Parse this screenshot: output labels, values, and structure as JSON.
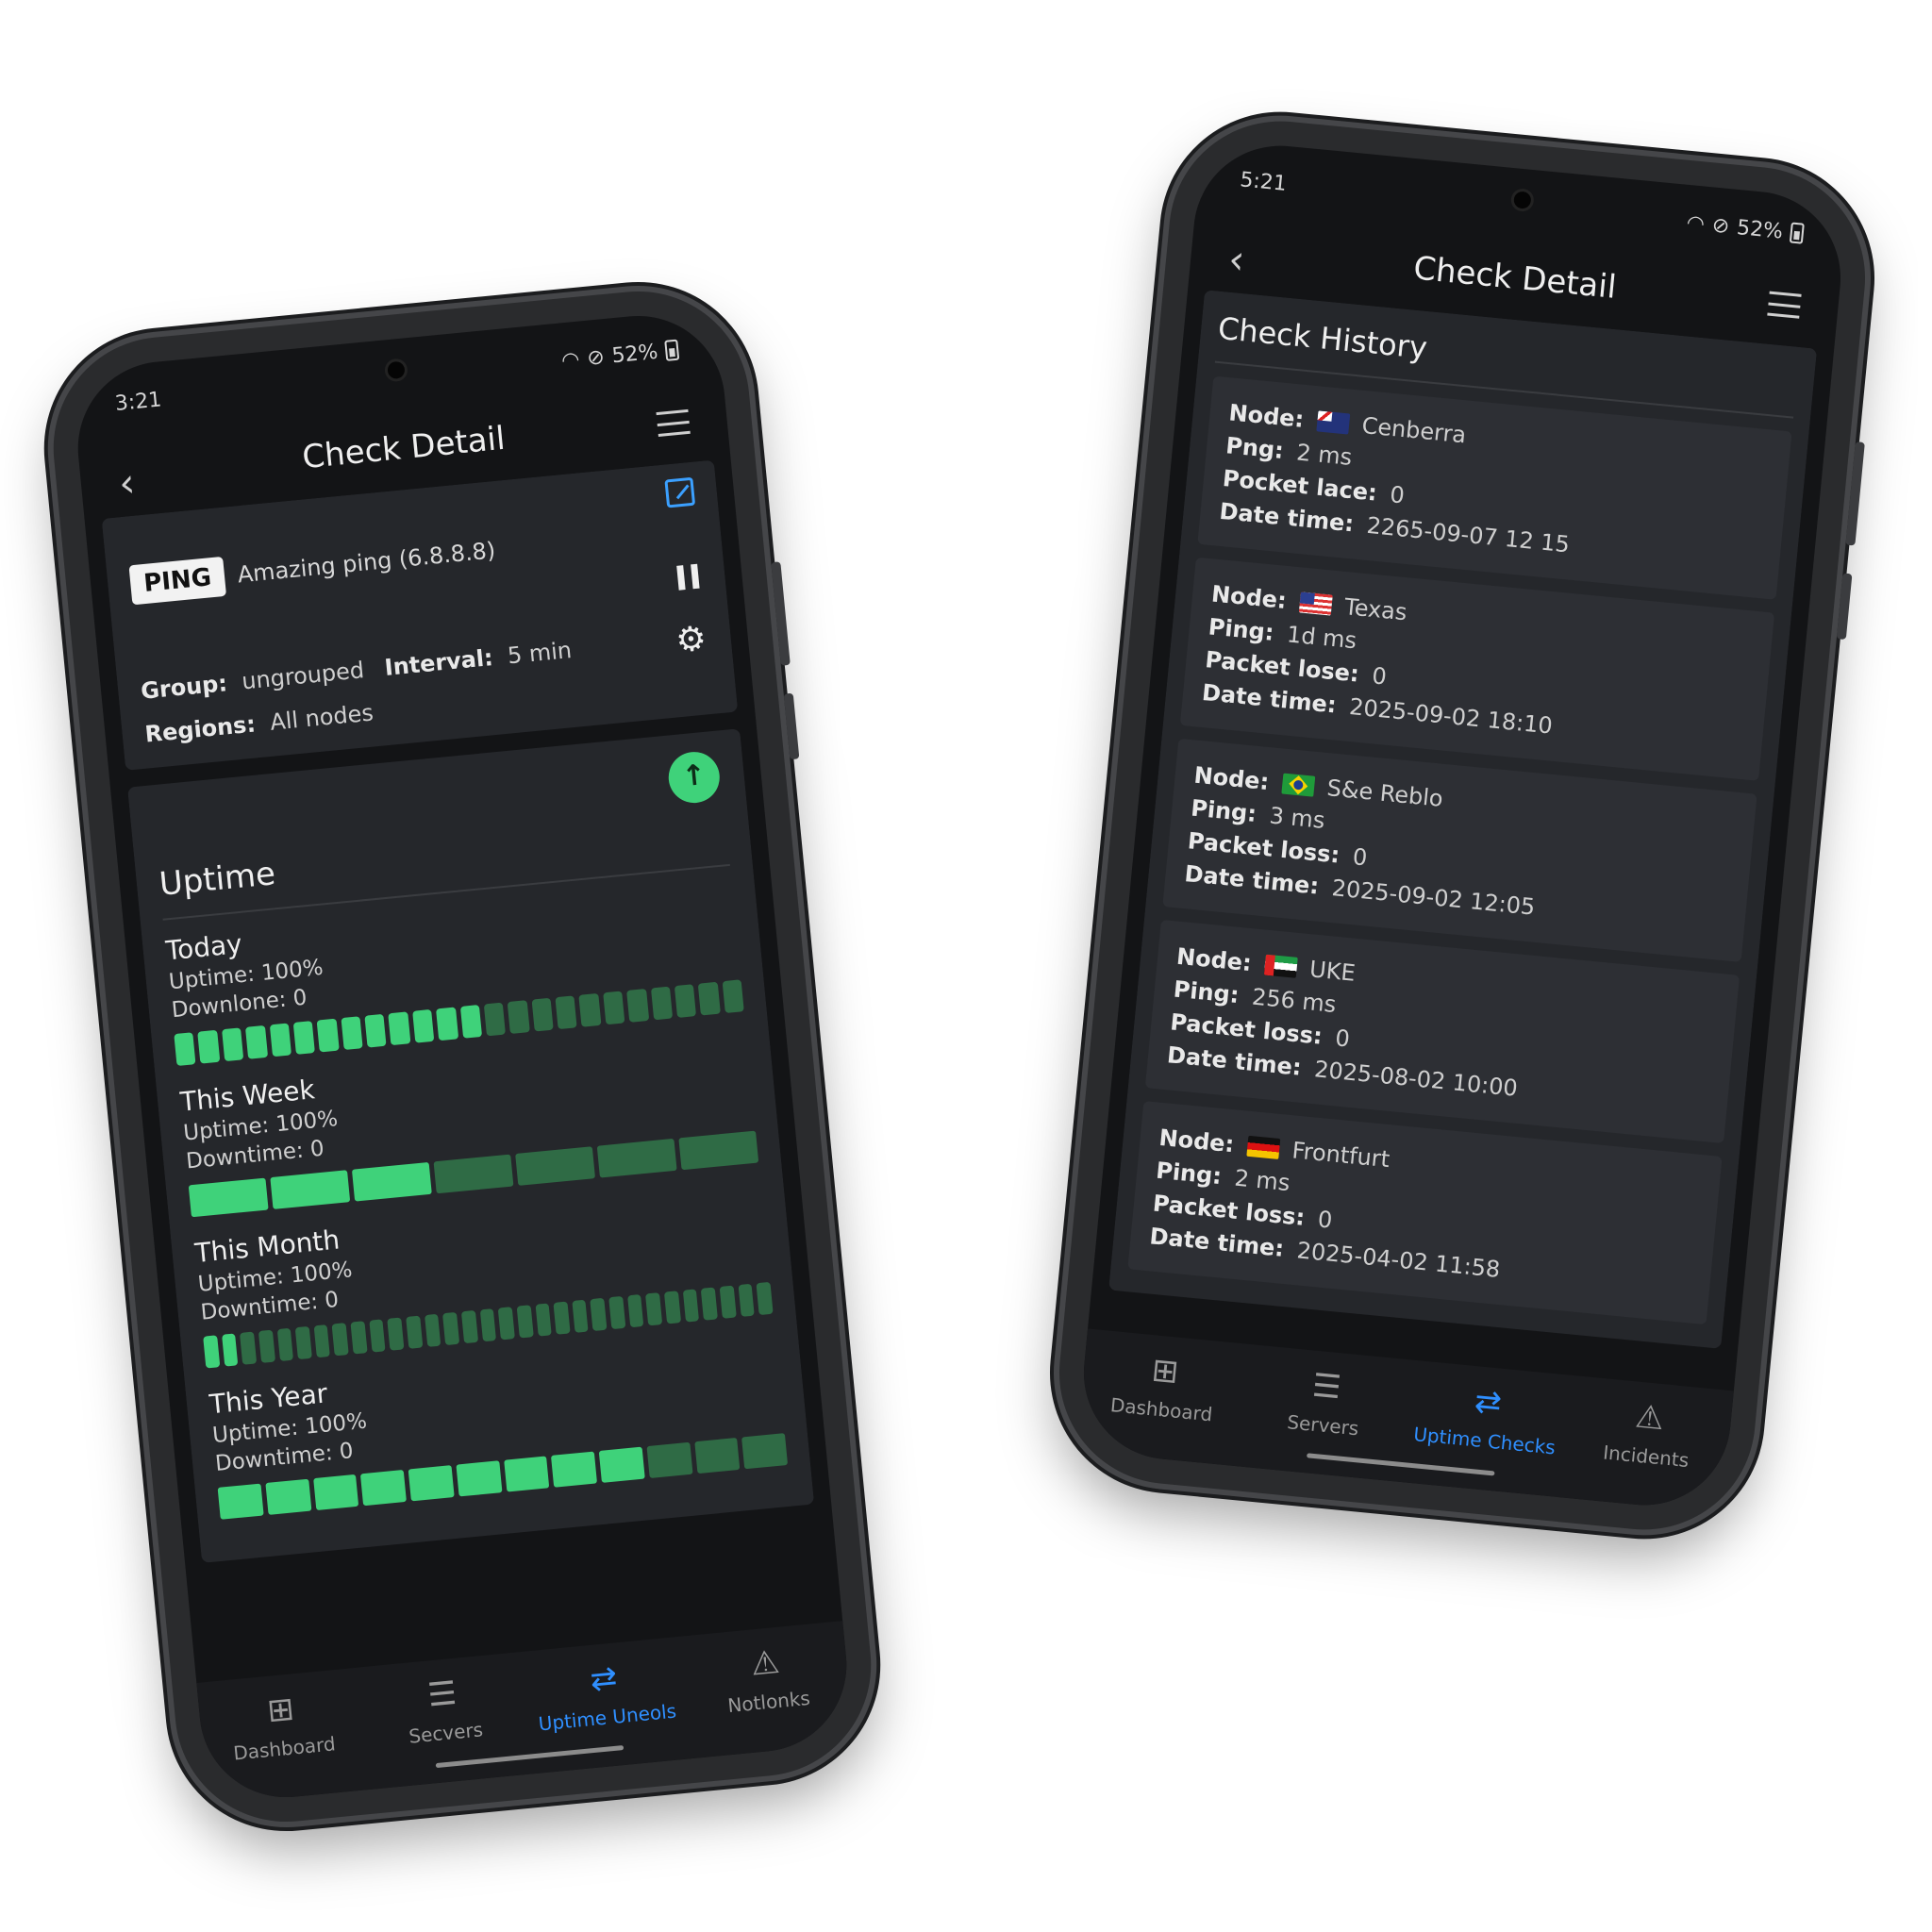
{
  "left_phone": {
    "status": {
      "time": "3:21",
      "battery": "52%"
    },
    "header": {
      "title": "Check Detail"
    },
    "check": {
      "type": "PING",
      "name": "Amazing ping (6.8.8.8)",
      "group_label": "Group:",
      "group_value": "ungrouped",
      "interval_label": "Interval:",
      "interval_value": "5 min",
      "regions_label": "Regions:",
      "regions_value": "All nodes"
    },
    "uptime": {
      "title": "Uptime",
      "status_icon": "arrow-up-icon",
      "periods": [
        {
          "name": "Today",
          "uptime": "Uptime: 100%",
          "downtime": "Downlone: 0",
          "segments": 24,
          "active": 13
        },
        {
          "name": "This Week",
          "uptime": "Uptime: 100%",
          "downtime": "Downtime: 0",
          "segments": 7,
          "active": 3
        },
        {
          "name": "This Month",
          "uptime": "Uptime: 100%",
          "downtime": "Downtime: 0",
          "segments": 31,
          "active": 2
        },
        {
          "name": "This Year",
          "uptime": "Uptime: 100%",
          "downtime": "Downtime: 0",
          "segments": 12,
          "active": 9
        }
      ]
    },
    "nav": [
      {
        "label": "Dashboard",
        "icon": "grid-icon"
      },
      {
        "label": "Secvers",
        "icon": "server-icon"
      },
      {
        "label": "Uptime Uneols",
        "icon": "sync-icon",
        "active": true
      },
      {
        "label": "Notlonks",
        "icon": "warning-icon"
      }
    ]
  },
  "right_phone": {
    "status": {
      "time": "5:21",
      "battery": "52%"
    },
    "header": {
      "title": "Check Detail"
    },
    "history": {
      "title": "Check History",
      "entries": [
        {
          "node_label": "Node:",
          "node": "Cenberra",
          "flag": "au",
          "ping_label": "Png:",
          "ping": "2 ms",
          "loss_label": "Pocket lace:",
          "loss": "0",
          "date_label": "Date time:",
          "date": "2265-09-07 12 15"
        },
        {
          "node_label": "Node:",
          "node": "Texas",
          "flag": "us",
          "ping_label": "Ping:",
          "ping": "1d ms",
          "loss_label": "Packet lose:",
          "loss": "0",
          "date_label": "Date time:",
          "date": "2025-09-02 18:10"
        },
        {
          "node_label": "Node:",
          "node": "S&e Reblo",
          "flag": "br",
          "ping_label": "Ping:",
          "ping": "3 ms",
          "loss_label": "Packet loss:",
          "loss": "0",
          "date_label": "Date time:",
          "date": "2025-09-02 12:05"
        },
        {
          "node_label": "Node:",
          "node": "UKE",
          "flag": "ae",
          "ping_label": "Ping:",
          "ping": "256 ms",
          "loss_label": "Packet loss:",
          "loss": "0",
          "date_label": "Date time:",
          "date": "2025-08-02 10:00"
        },
        {
          "node_label": "Node:",
          "node": "Frontfurt",
          "flag": "de",
          "ping_label": "Ping:",
          "ping": "2 ms",
          "loss_label": "Packet loss:",
          "loss": "0",
          "date_label": "Date time:",
          "date": "2025-04-02 11:58"
        }
      ]
    },
    "nav": [
      {
        "label": "Dashboard",
        "icon": "grid-icon"
      },
      {
        "label": "Servers",
        "icon": "server-icon"
      },
      {
        "label": "Uptime Checks",
        "icon": "sync-icon",
        "active": true
      },
      {
        "label": "Incidents",
        "icon": "warning-icon"
      }
    ]
  },
  "colors": {
    "accent": "#2f8fff",
    "up": "#3fd27a",
    "up_dim": "#2f6b45",
    "surface": "#25272b",
    "background": "#131416"
  }
}
